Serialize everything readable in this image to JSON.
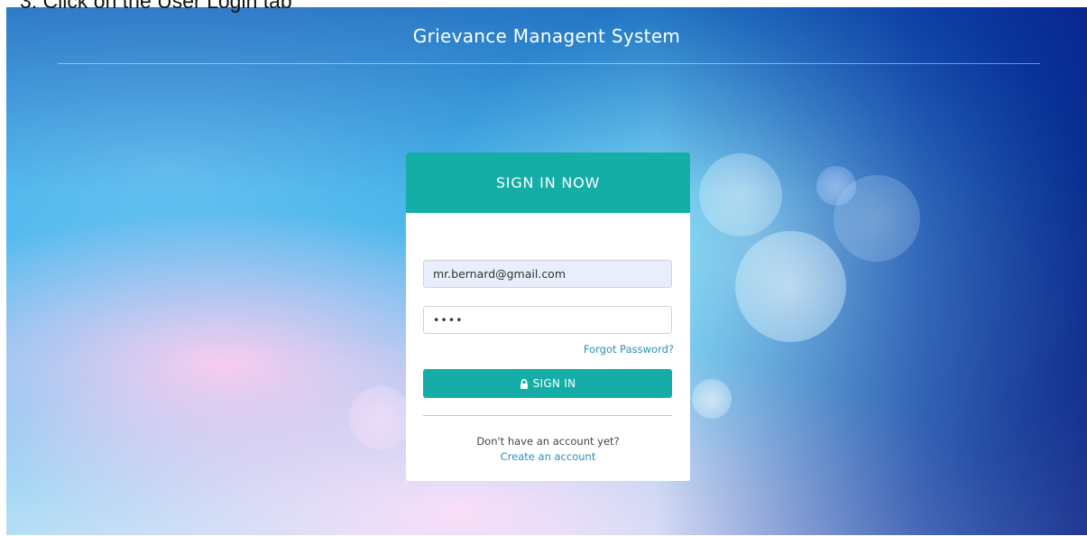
{
  "caption": "3.  Click on the User Login tab",
  "header": {
    "title": "Grievance Managent System"
  },
  "login_card": {
    "heading": "SIGN IN NOW",
    "email_value": "mr.bernard@gmail.com",
    "password_value": "••••",
    "forgot_label": "Forgot Password?",
    "sign_in_label": "SIGN IN",
    "sign_in_icon": "lock-icon",
    "no_account_text": "Don't have an account yet?",
    "create_account_label": "Create an account"
  },
  "colors": {
    "accent": "#14aea7",
    "link": "#2a8fb6"
  }
}
